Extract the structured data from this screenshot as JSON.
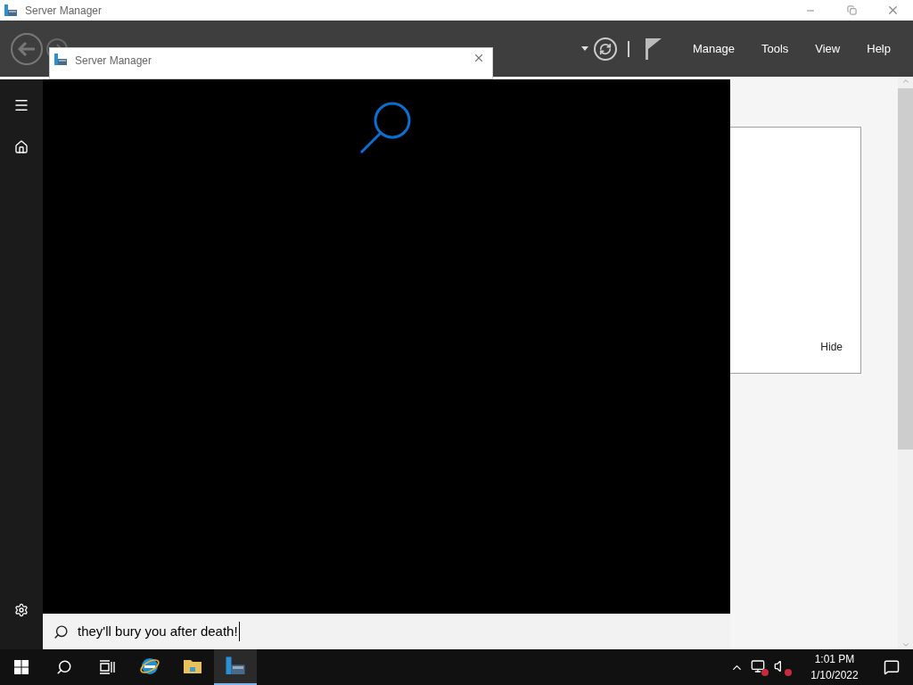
{
  "app_window": {
    "title": "Server Manager",
    "menu": [
      "Manage",
      "Tools",
      "View",
      "Help"
    ],
    "card": {
      "link": "Hide"
    }
  },
  "popup_window": {
    "title": "Server Manager"
  },
  "search": {
    "value": "they'll bury you after death!"
  },
  "taskbar": {
    "pinned": [
      {
        "kind": "browser",
        "running": false
      },
      {
        "kind": "folder",
        "running": false
      },
      {
        "kind": "server",
        "running": true
      }
    ]
  },
  "clock": {
    "time": "1:01 PM",
    "date": "1/10/2022"
  }
}
